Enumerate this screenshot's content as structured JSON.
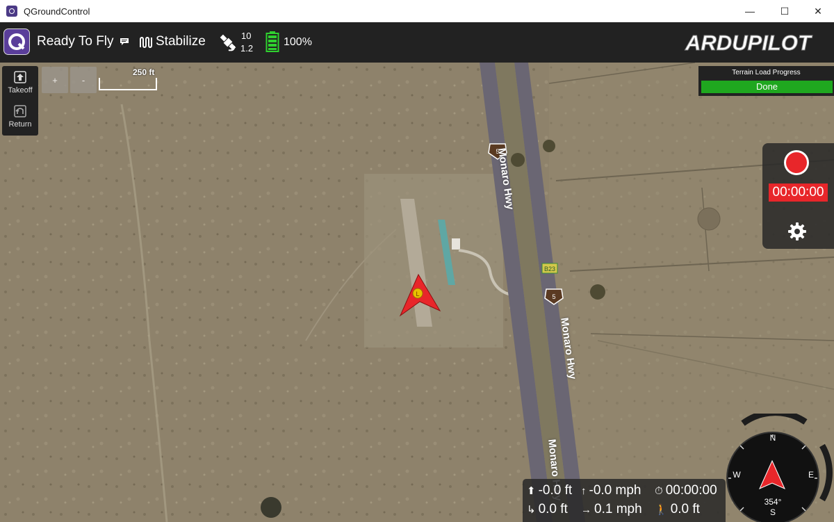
{
  "window": {
    "title": "QGroundControl",
    "minimize": "—",
    "maximize": "☐",
    "close": "✕"
  },
  "toolbar": {
    "status": "Ready To Fly",
    "flight_mode": "Stabilize",
    "satellite_count": "10",
    "hdop": "1.2",
    "battery": "100%",
    "brand": "ARDUPILOT",
    "brand_color": "#f5c400"
  },
  "map_tools": {
    "takeoff": "Takeoff",
    "return": "Return",
    "zoom_in": "+",
    "zoom_out": "-",
    "scale": "250 ft"
  },
  "terrain": {
    "label": "Terrain Load Progress",
    "value": "Done"
  },
  "recording": {
    "time": "00:00:00",
    "color": "#e8262a"
  },
  "map_labels": {
    "highway": "Monaro Hwy",
    "route_shield": "5",
    "route_marker": "B23",
    "vehicle_marker": "L"
  },
  "telemetry": {
    "altitude": "-0.0 ft",
    "vertical_speed": "-0.0 mph",
    "flight_time": "00:00:00",
    "distance": "0.0 ft",
    "ground_speed": "0.1 mph",
    "distance_to_home": "0.0 ft"
  },
  "compass": {
    "heading": "354°",
    "n": "N",
    "e": "E",
    "s": "S",
    "w": "W"
  }
}
